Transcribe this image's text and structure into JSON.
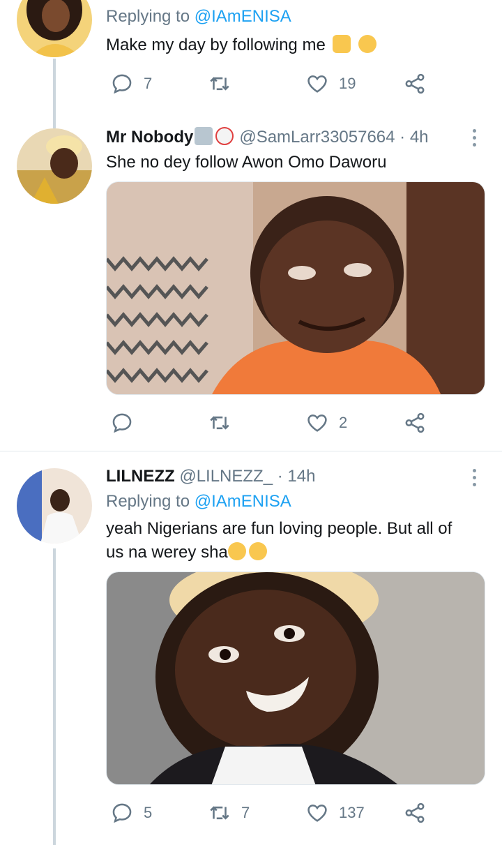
{
  "tweets": [
    {
      "reply_label": "Replying to",
      "reply_handle": "@IAmENISA",
      "text": "Make my day by following me",
      "actions": {
        "reply_count": "7",
        "retweet_count": "",
        "like_count": "19"
      },
      "emoji_icons": [
        "folded-hands-icon",
        "rolling-eyes-face-icon"
      ]
    },
    {
      "name": "Mr Nobody",
      "handle": "@SamLarr33057664",
      "time": "· 4h",
      "text": "She no dey follow Awon Omo Daworu",
      "actions": {
        "reply_count": "",
        "retweet_count": "",
        "like_count": "2"
      },
      "name_icons": [
        "mountain-snow-icon",
        "clown-face-icon"
      ]
    },
    {
      "name": "LILNEZZ",
      "handle": "@LILNEZZ_",
      "time": "· 14h",
      "reply_label": "Replying to",
      "reply_handle": "@IAmENISA",
      "text_line1": "yeah Nigerians are fun loving people. But all of",
      "text_line2": "us na werey sha",
      "actions": {
        "reply_count": "5",
        "retweet_count": "7",
        "like_count": "137"
      },
      "emoji_icons": [
        "tears-of-joy-icon",
        "tears-of-joy-icon"
      ]
    }
  ],
  "colors": {
    "accent": "#1da1f2",
    "secondary_text": "#657786",
    "primary_text": "#14171a",
    "divider": "#e1e8ed"
  }
}
